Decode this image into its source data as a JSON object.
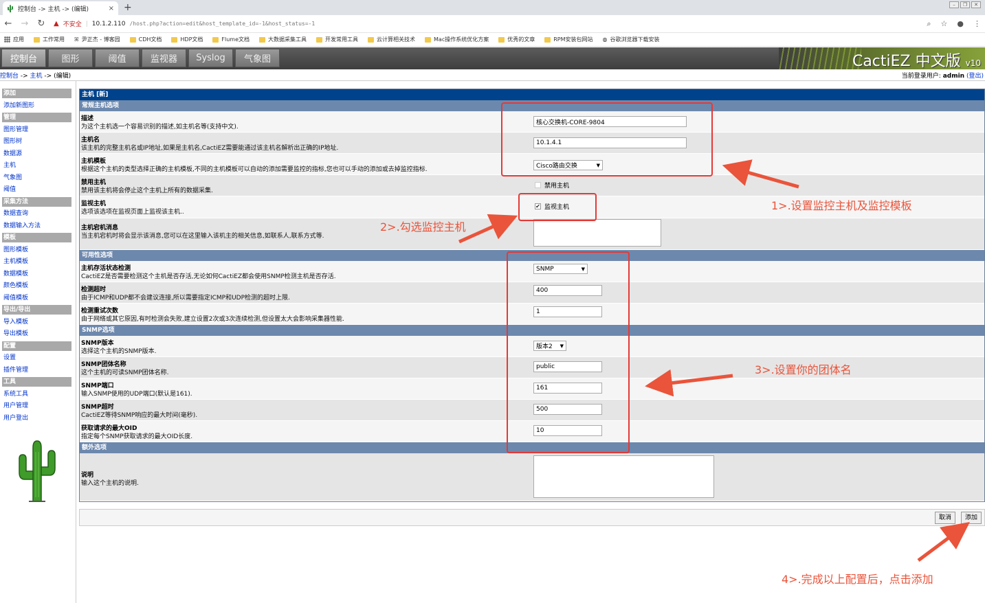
{
  "browser": {
    "tab_title": "控制台 -> 主机 -> (编辑)",
    "tab_close": "×",
    "new_tab": "+",
    "insecure_label": "不安全",
    "url_host": "10.1.2.110",
    "url_path": "/host.php?action=edit&host_template_id=-1&host_status=-1",
    "bookmarks": [
      "应用",
      "工作常用",
      "尹正杰 - 博客园",
      "CDH文档",
      "HDP文档",
      "Flume文档",
      "大数据采集工具",
      "开发常用工具",
      "云计算相关技术",
      "Mac操作系统优化方案",
      "优秀的文章",
      "RPM安装包网站",
      "谷歌浏览器下载安装"
    ]
  },
  "header": {
    "tabs": [
      "控制台",
      "图形",
      "阈值",
      "监视器",
      "Syslog",
      "气象图"
    ],
    "brand": "CactiEZ 中文版",
    "brand_version": "v10"
  },
  "breadcrumb": {
    "console": "控制台",
    "arrow1": " -> ",
    "hosts": "主机",
    "arrow2": " -> ",
    "current": "(编辑)"
  },
  "user": {
    "prefix": "当前登录用户: ",
    "name": "admin",
    "logout": "(登出)"
  },
  "menu": [
    {
      "type": "head",
      "label": "添加"
    },
    {
      "type": "item",
      "label": "添加新图形"
    },
    {
      "type": "head",
      "label": "管理"
    },
    {
      "type": "item",
      "label": "图形管理"
    },
    {
      "type": "item",
      "label": "图形树"
    },
    {
      "type": "item",
      "label": "数据源"
    },
    {
      "type": "item",
      "label": "主机"
    },
    {
      "type": "item",
      "label": "气象图"
    },
    {
      "type": "item",
      "label": "阈值"
    },
    {
      "type": "head",
      "label": "采集方法"
    },
    {
      "type": "item",
      "label": "数据查询"
    },
    {
      "type": "item",
      "label": "数据输入方法"
    },
    {
      "type": "head",
      "label": "模板"
    },
    {
      "type": "item",
      "label": "图形模板"
    },
    {
      "type": "item",
      "label": "主机模板"
    },
    {
      "type": "item",
      "label": "数据模板"
    },
    {
      "type": "item",
      "label": "颜色模板"
    },
    {
      "type": "item",
      "label": "阈值模板"
    },
    {
      "type": "head",
      "label": "导出/导出"
    },
    {
      "type": "item",
      "label": "导入模板"
    },
    {
      "type": "item",
      "label": "导出模板"
    },
    {
      "type": "head",
      "label": "配置"
    },
    {
      "type": "item",
      "label": "设置"
    },
    {
      "type": "item",
      "label": "插件管理"
    },
    {
      "type": "head",
      "label": "工具"
    },
    {
      "type": "item",
      "label": "系统工具"
    },
    {
      "type": "item",
      "label": "用户管理"
    },
    {
      "type": "item",
      "label": "用户登出"
    }
  ],
  "form": {
    "title": "主机 [新]",
    "sections": {
      "general": "常规主机选项",
      "availability": "可用性选项",
      "snmp": "SNMP选项",
      "extra": "额外选项"
    },
    "fields": {
      "description": {
        "title": "描述",
        "desc": "为这个主机选一个容易识别的描述,如主机名等(支持中文).",
        "value": "核心交换机-CORE-9804"
      },
      "hostname": {
        "title": "主机名",
        "desc": "该主机的完整主机名或IP地址,如果是主机名,CactiEZ需要能通过该主机名解析出正确的IP地址.",
        "value": "10.1.4.1"
      },
      "host_template": {
        "title": "主机模板",
        "desc": "根据这个主机的类型选择正确的主机模板,不同的主机模板可以自动的添加需要监控的指标,您也可以手动的添加或去掉监控指标.",
        "value": "Cisco路由交换"
      },
      "disable": {
        "title": "禁用主机",
        "desc": "禁用该主机将会停止这个主机上所有的数据采集.",
        "checkbox_label": "禁用主机",
        "checked": false
      },
      "monitor": {
        "title": "监视主机",
        "desc": "选项该选项在监视页面上监视该主机..",
        "checkbox_label": "监视主机",
        "checked": true
      },
      "down_message": {
        "title": "主机宕机消息",
        "desc": "当主机宕机时将会显示该消息,您可以在这里输入该机主的相关信息,如联系人,联系方式等."
      },
      "availability_method": {
        "title": "主机存活状态检测",
        "desc": "CactiEZ是否需要检测这个主机是否存活,无论如何CactiEZ都会使用SNMP检测主机是否存活.",
        "value": "SNMP"
      },
      "ping_timeout": {
        "title": "检测超时",
        "desc": "由于ICMP和UDP都不会建议连接,所以需要指定ICMP和UDP检测的超时上限.",
        "value": "400"
      },
      "ping_retries": {
        "title": "检测重试次数",
        "desc": "由于网络或其它原因,有时检测会失败,建立设置2次或3次连续检测,但设置太大会影响采集器性能.",
        "value": "1"
      },
      "snmp_version": {
        "title": "SNMP版本",
        "desc": "选择这个主机的SNMP版本.",
        "value": "版本2"
      },
      "snmp_community": {
        "title": "SNMP团体名称",
        "desc": "这个主机的可读SNMP团体名称.",
        "value": "public"
      },
      "snmp_port": {
        "title": "SNMP端口",
        "desc": "输入SNMP使用的UDP端口(默认是161).",
        "value": "161"
      },
      "snmp_timeout": {
        "title": "SNMP超时",
        "desc": "CactiEZ等待SNMP响应的最大时间(毫秒).",
        "value": "500"
      },
      "max_oids": {
        "title": "获取请求的最大OID",
        "desc": "指定每个SNMP获取请求的最大OID长度.",
        "value": "10"
      },
      "notes": {
        "title": "说明",
        "desc": "输入这个主机的说明."
      }
    },
    "buttons": {
      "cancel": "取消",
      "add": "添加"
    }
  },
  "annotations": {
    "step1": "1>.设置监控主机及监控模板",
    "step2": "2>.勾选监控主机",
    "step3": "3>.设置你的团体名",
    "step4": "4>.完成以上配置后，点击添加",
    "color": "#e9543b"
  }
}
